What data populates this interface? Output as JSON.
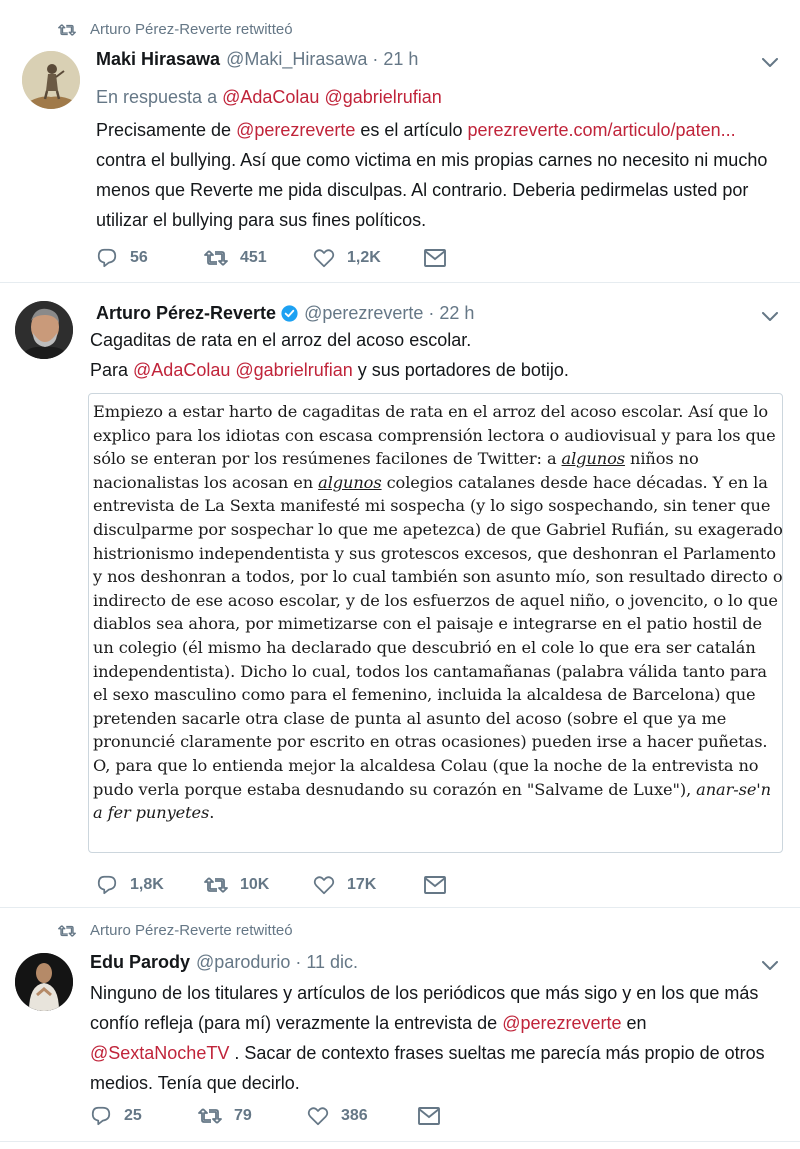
{
  "tweets": [
    {
      "retweet_context": "Arturo Pérez-Reverte retwitteó",
      "name": "Maki Hirasawa",
      "handle": "@Maki_Hirasawa",
      "separator": "·",
      "time": "21 h",
      "reply_prefix": "En respuesta a",
      "reply_to_1": "@AdaColau",
      "reply_to_2": "@gabrielrufian",
      "text_1": "Precisamente de ",
      "mention": "@perezreverte",
      "text_2": " es el artículo ",
      "link": "perezreverte.com/articulo/paten...",
      "text_3": " contra el bullying. Así que como victima en mis propias carnes no necesito ni mucho menos que Reverte me pida disculpas. Al contrario. Deberia pedirmelas usted por utilizar el bullying para sus fines políticos.",
      "replies": "56",
      "retweets": "451",
      "likes": "1,2K"
    },
    {
      "name": "Arturo Pérez-Reverte",
      "handle": "@perezreverte",
      "separator": "·",
      "time": "22 h",
      "line_1": "Cagaditas de rata en el arroz del acoso escolar.",
      "line_2_prefix": "Para ",
      "mention_1": "@AdaColau",
      "mention_2": "@gabrielrufian",
      "line_2_suffix": " y sus portadores de botijo.",
      "quote_a": "Empiezo a estar harto de cagaditas de rata en el arroz del acoso escolar. Así que  lo explico para los idiotas con escasa comprensión lectora o audiovisual y para los que sólo se enteran por los resúmenes facilones de Twitter: a ",
      "quote_u1": "algunos",
      "quote_b": " niños no nacionalistas los acosan en ",
      "quote_u2": "algunos",
      "quote_c": " colegios catalanes desde hace décadas. Y en la entrevista de La Sexta manifesté mi sospecha (y lo sigo sospechando, sin tener que disculparme por sospechar lo que me apetezca) de que Gabriel Rufián, su exagerado histrionismo independentista y sus grotescos excesos, que deshonran el Parlamento y nos deshonran a todos, por lo cual también son asunto mío, son resultado directo o indirecto de ese acoso escolar, y de los esfuerzos de aquel niño, o jovencito, o lo que diablos sea ahora, por mimetizarse con el paisaje e integrarse en el patio hostil de un colegio (él mismo ha declarado que descubrió en el cole lo que era ser catalán independentista). Dicho lo cual, todos los cantamañanas (palabra válida tanto para el sexo masculino como para el femenino, incluida la alcaldesa de Barcelona) que pretenden sacarle otra clase de punta al asunto del acoso (sobre el que ya me pronuncié claramente por escrito en otras ocasiones) pueden irse a hacer puñetas. O, para que lo entienda mejor la alcaldesa Colau (que la noche de la entrevista no pudo verla porque estaba desnudando su corazón en \"Salvame de Luxe\"), ",
      "quote_i": "anar-se'n a fer punyetes",
      "quote_end": ".",
      "replies": "1,8K",
      "retweets": "10K",
      "likes": "17K"
    },
    {
      "retweet_context": "Arturo Pérez-Reverte retwitteó",
      "name": "Edu Parody",
      "handle": "@parodurio",
      "separator": "·",
      "time": "11 dic.",
      "text_1": "Ninguno de los titulares y artículos de los periódicos que más sigo y en los que más confío refleja (para mí) verazmente la entrevista de ",
      "mention_1": "@perezreverte",
      "text_2": " en ",
      "mention_2": "@SextaNocheTV",
      "text_3": " . Sacar de contexto frases sueltas me parecía más propio de otros medios. Tenía que decirlo.",
      "replies": "25",
      "retweets": "79",
      "likes": "386"
    }
  ],
  "colors": {
    "link": "#c0243a",
    "muted": "#657786",
    "verified": "#1da1f2"
  },
  "icons": [
    "retweet-icon",
    "chevron-down-icon",
    "reply-icon",
    "like-icon",
    "message-icon",
    "verified-badge-icon"
  ]
}
